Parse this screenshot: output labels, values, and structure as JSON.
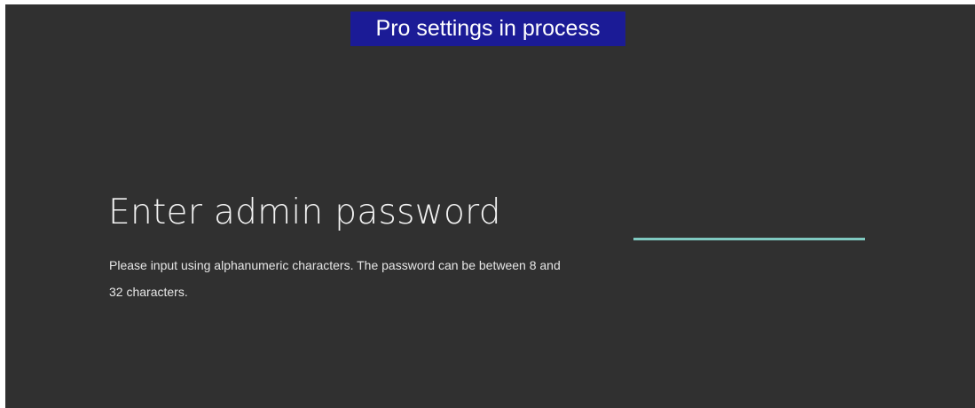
{
  "banner": {
    "text": "Pro settings in process"
  },
  "main": {
    "title": "Enter admin password",
    "description": "Please input using alphanumeric characters. The password can be between 8 and 32 characters."
  },
  "password": {
    "value": "",
    "placeholder": ""
  },
  "colors": {
    "background": "#303030",
    "banner_bg": "#1b1b96",
    "accent_underline": "#7fc9c0"
  }
}
